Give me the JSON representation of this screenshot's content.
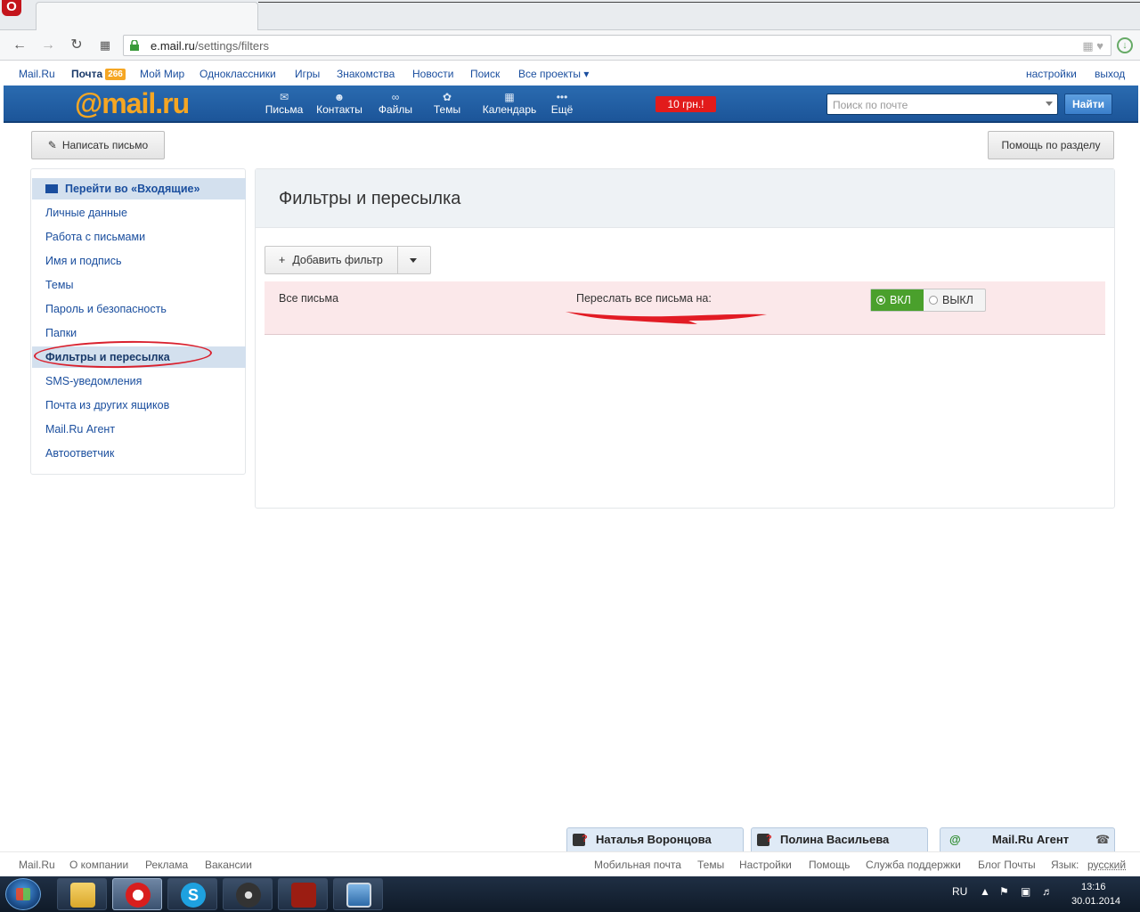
{
  "browser": {
    "url_host": "e.mail.ru",
    "url_path": "/settings/filters",
    "opera_logo": "O"
  },
  "portal": {
    "links": [
      "Mail.Ru",
      "Почта",
      "Мой Мир",
      "Одноклассники",
      "Игры",
      "Знакомства",
      "Новости",
      "Поиск",
      "Все проекты"
    ],
    "mail_count": "266",
    "settings": "настройки",
    "logout": "выход"
  },
  "header": {
    "logo_at": "@mail",
    "logo_ru": ".ru",
    "nav": [
      {
        "label": "Письма",
        "icon": "envelope-icon"
      },
      {
        "label": "Контакты",
        "icon": "contacts-icon"
      },
      {
        "label": "Файлы",
        "icon": "paperclip-icon"
      },
      {
        "label": "Темы",
        "icon": "palette-icon"
      },
      {
        "label": "Календарь",
        "icon": "calendar-icon"
      },
      {
        "label": "Ещё",
        "icon": "more-icon"
      }
    ],
    "promo": "10 грн.!",
    "search_placeholder": "Поиск по почте",
    "search_button": "Найти"
  },
  "toolbar": {
    "compose": "Написать письмо",
    "help": "Помощь по разделу"
  },
  "sidebar": {
    "inbox": "Перейти во «Входящие»",
    "items": [
      "Личные данные",
      "Работа с письмами",
      "Имя и подпись",
      "Темы",
      "Пароль и безопасность",
      "Папки",
      "Фильтры и пересылка",
      "SMS-уведомления",
      "Почта из других ящиков",
      "Mail.Ru Агент",
      "Автоответчик"
    ],
    "active_index": 6
  },
  "main": {
    "title": "Фильтры и пересылка",
    "add_filter": "Добавить фильтр",
    "filter": {
      "name": "Все письма",
      "action": "Переслать все письма на:",
      "on_label": "ВКЛ",
      "off_label": "ВЫКЛ",
      "state": "on"
    }
  },
  "chat": {
    "contacts": [
      "Наталья Воронцова",
      "Полина Васильева"
    ],
    "agent": "Mail.Ru Агент"
  },
  "footer": {
    "left": [
      "Mail.Ru",
      "О компании",
      "Реклама",
      "Вакансии"
    ],
    "right": [
      "Мобильная почта",
      "Темы",
      "Настройки",
      "Помощь",
      "Служба поддержки",
      "Блог Почты"
    ],
    "lang_label": "Язык:",
    "lang_value": "русский"
  },
  "taskbar": {
    "lang": "RU",
    "time": "13:16",
    "date": "30.01.2014"
  },
  "colors": {
    "header_blue": "#1c5599",
    "logo_orange": "#f5a623",
    "toggle_green": "#4aa02c",
    "filter_row_pink": "#fbe8ea",
    "annotation_red": "#d9212e"
  }
}
